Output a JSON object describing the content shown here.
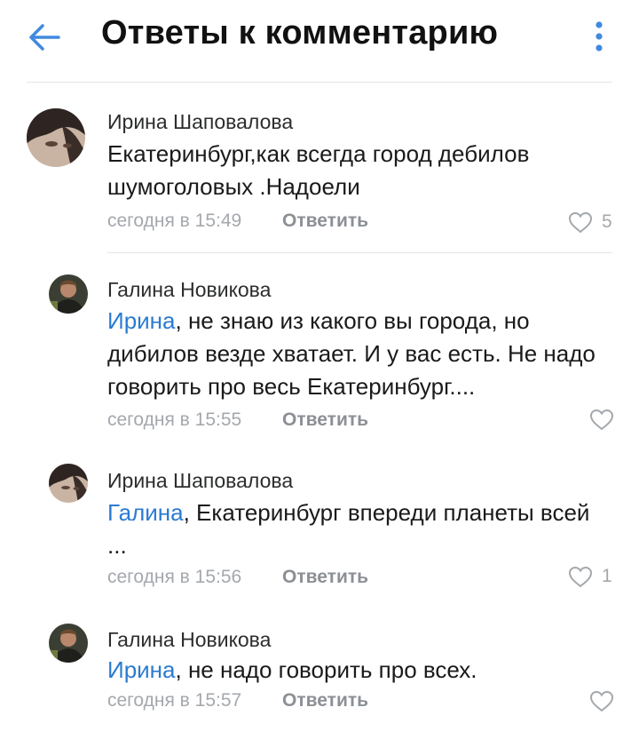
{
  "header": {
    "title": "Ответы к комментарию",
    "back_icon": "arrow-left-icon",
    "menu_icon": "kebab-menu-icon",
    "accent_color": "#3f8ae0"
  },
  "comments": [
    {
      "author": "Ирина Шаповалова",
      "mention": "",
      "text": "Екатеринбург,как всегда город дебилов шумоголовых .Надоели",
      "time": "сегодня в 15:49",
      "reply_label": "Ответить",
      "likes": "5"
    },
    {
      "author": "Галина Новикова",
      "mention": "Ирина",
      "text": ",  не знаю из какого вы города, но дибилов везде хватает. И у вас есть. Не надо говорить про весь Екатеринбург....",
      "time": "сегодня в 15:55",
      "reply_label": "Ответить",
      "likes": ""
    },
    {
      "author": "Ирина Шаповалова",
      "mention": "Галина",
      "text": ", Екатеринбург впереди планеты всей ...",
      "time": "сегодня в 15:56",
      "reply_label": "Ответить",
      "likes": "1"
    },
    {
      "author": "Галина Новикова",
      "mention": "Ирина",
      "text": ", не надо говорить про всех.",
      "time": "сегодня в 15:57",
      "reply_label": "Ответить",
      "likes": ""
    }
  ],
  "colors": {
    "mention": "#2a7bd1",
    "meta": "#a4a8ad",
    "divider": "#e3e4e6"
  }
}
